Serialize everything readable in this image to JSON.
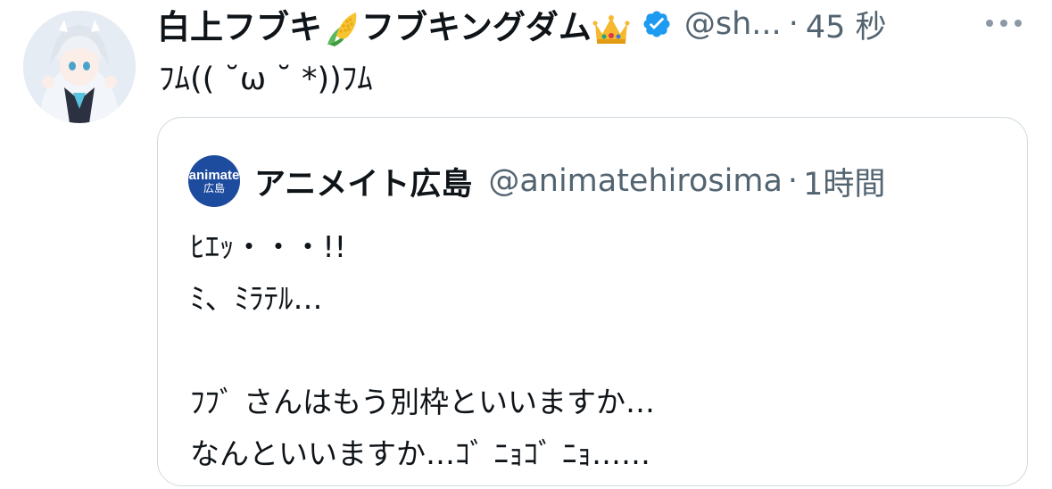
{
  "tweet": {
    "display_name_part1": "白上フブキ",
    "display_name_part2": "フブキングダム",
    "emoji_1": "corn-emoji",
    "emoji_2": "crown-emoji",
    "verified_icon": "verified-badge-icon",
    "handle": "@sh...",
    "separator": "·",
    "time": "45 秒",
    "more_icon": "more-horizontal-icon",
    "text": "ﾌﾑ(( ˘ω ˘ *))ﾌﾑ"
  },
  "quote": {
    "avatar_line1": "animate",
    "avatar_line2": "広島",
    "display_name": "アニメイト広島",
    "handle": "@animatehirosima",
    "separator": "·",
    "time": "1時間",
    "lines": [
      "ﾋｴｯ・・・!!",
      "ﾐ、ﾐﾗﾃﾙ…",
      "",
      "ﾌﾌﾞ さんはもう別枠といいますか…",
      "なんといいますか…ｺﾞ ﾆｮｺﾞ ﾆｮ……"
    ]
  },
  "colors": {
    "text_primary": "#0f1419",
    "text_secondary": "#536471",
    "verified_blue": "#1d9bf0",
    "border": "#cfd9de",
    "animate_blue": "#1d4b9e"
  }
}
